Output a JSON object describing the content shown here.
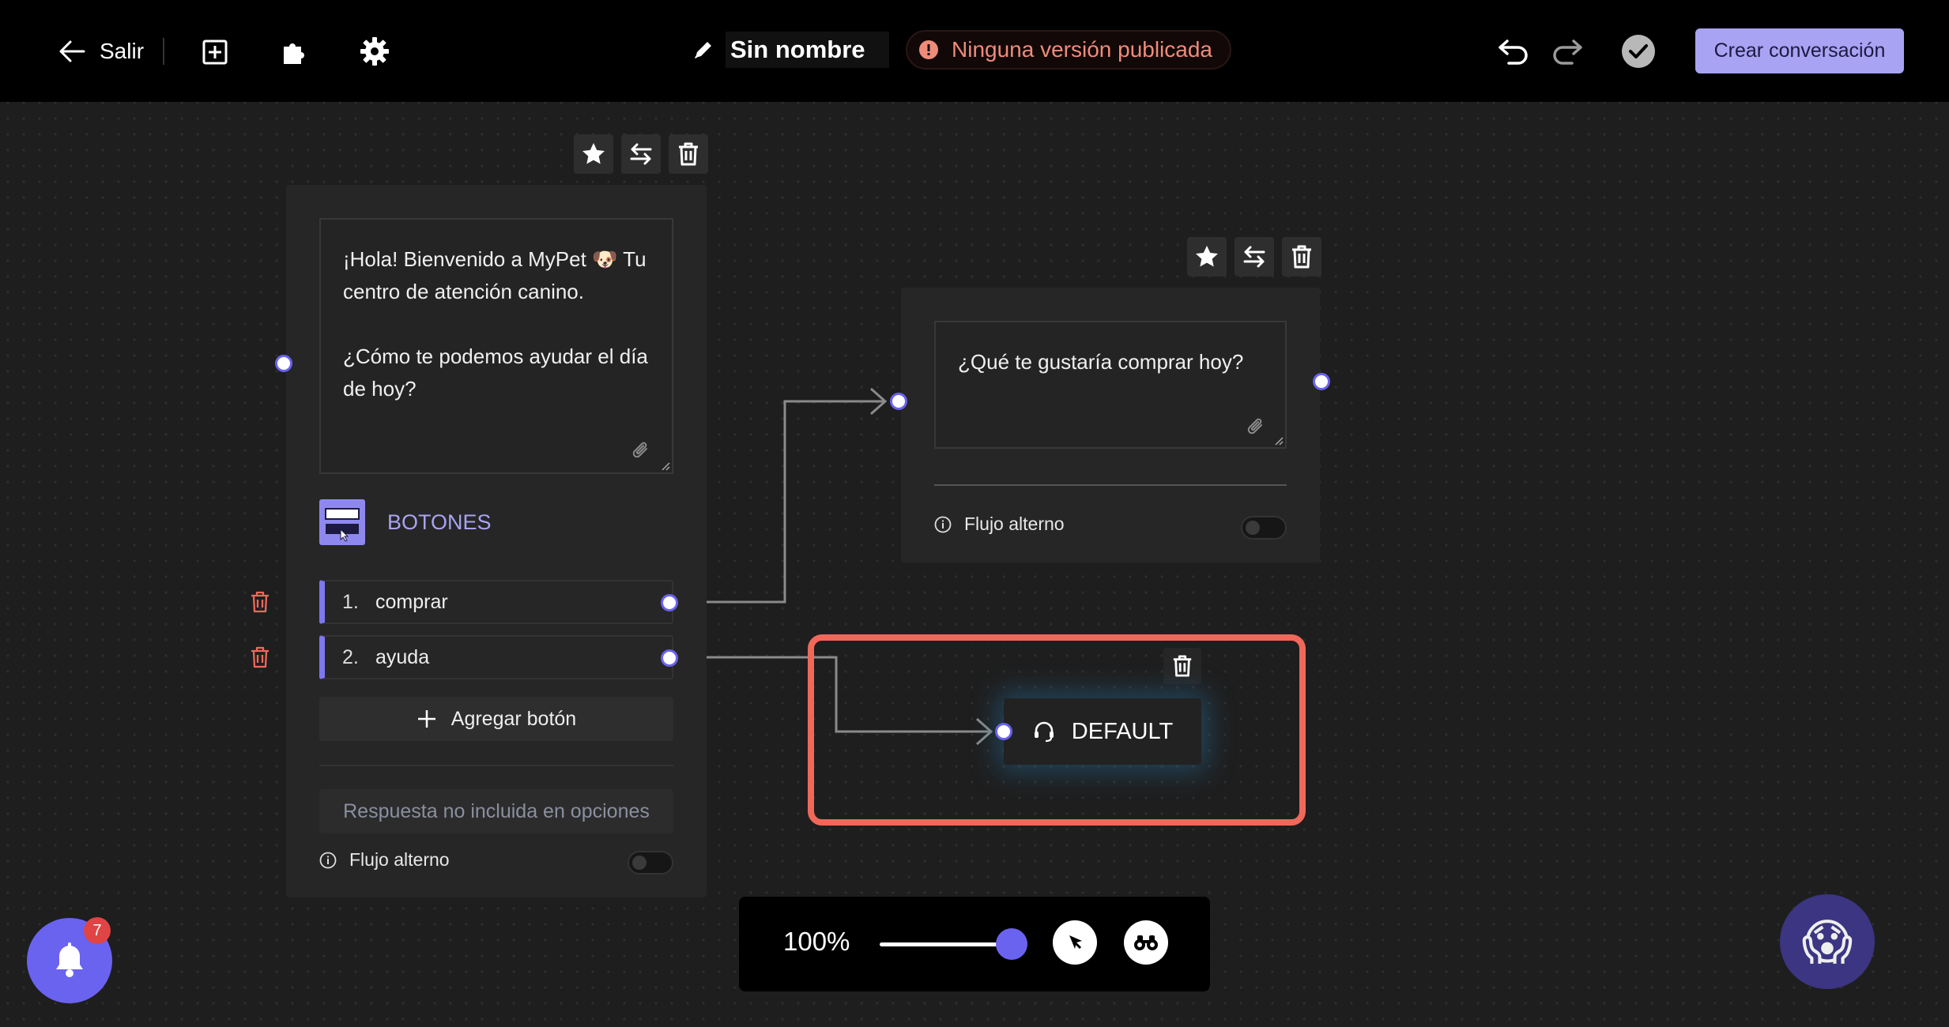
{
  "topbar": {
    "exit_label": "Salir",
    "title": "Sin nombre",
    "status_badge": "Ninguna versión publicada",
    "create_label": "Crear conversación"
  },
  "nodes": {
    "welcome": {
      "message": "¡Hola! Bienvenido a MyPet 🐶 Tu centro de atención canino.\n\n¿Cómo te podemos ayudar el día de hoy?",
      "section_label": "BOTONES",
      "options": [
        {
          "num": "1.",
          "label": "comprar"
        },
        {
          "num": "2.",
          "label": "ayuda"
        }
      ],
      "add_button_label": "Agregar botón",
      "fallback_label": "Respuesta no incluida en opciones",
      "flujo_label": "Flujo alterno"
    },
    "shop": {
      "message": "¿Qué te gustaría comprar hoy?",
      "flujo_label": "Flujo alterno"
    },
    "default": {
      "label": "DEFAULT"
    }
  },
  "zoom": {
    "label": "100%",
    "level_percent": 100
  },
  "notifications": {
    "count": "7"
  },
  "colors": {
    "accent": "#6a63ef",
    "create_button": "#a8a3f2",
    "highlight_box": "#f0685a",
    "badge_text": "#f08b7a"
  }
}
